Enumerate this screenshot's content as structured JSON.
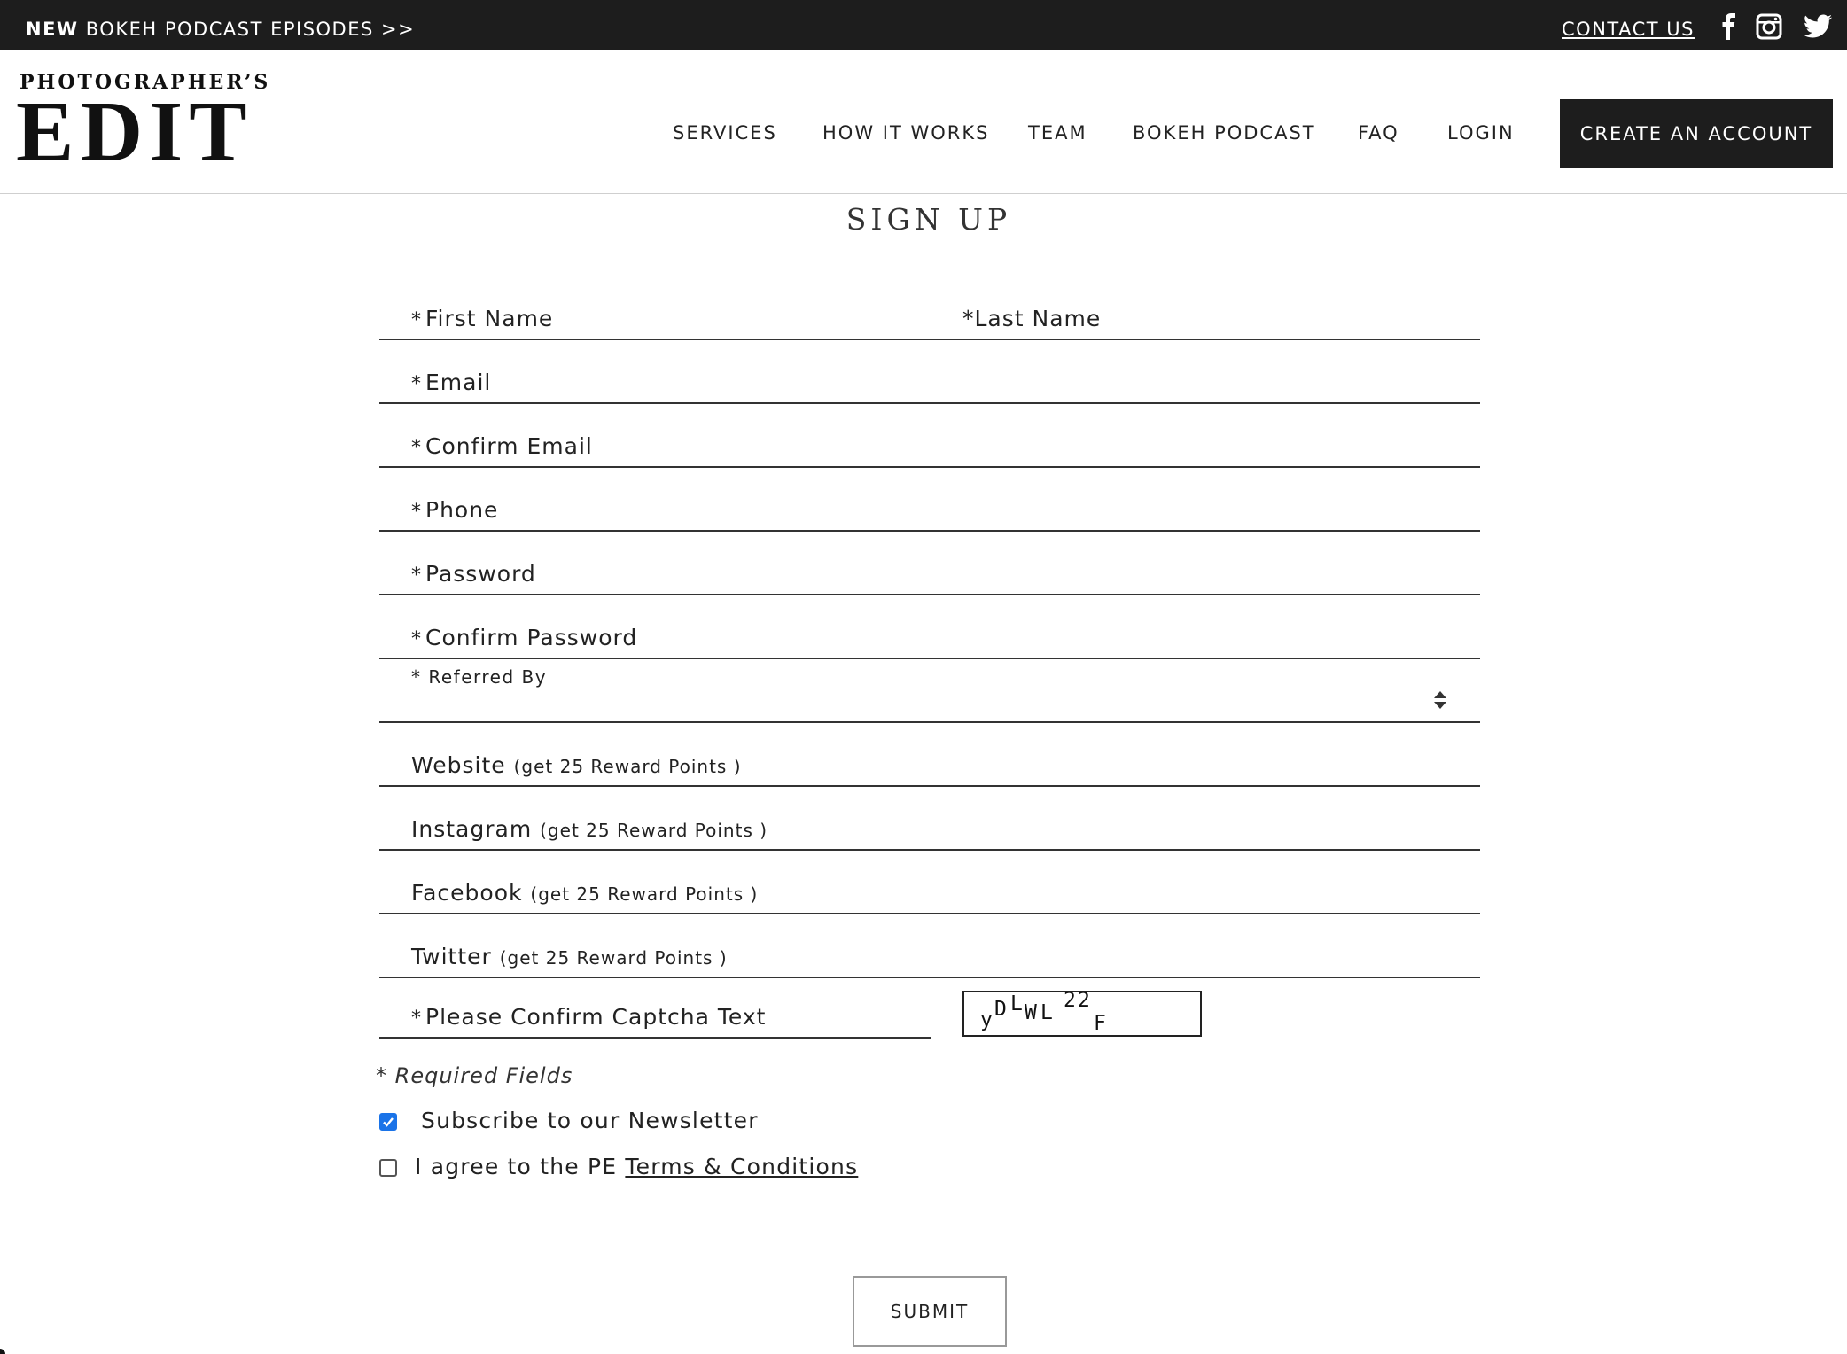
{
  "topbar": {
    "promo_strong": "NEW",
    "promo_text": " BOKEH PODCAST EPISODES >>",
    "contact": "CONTACT US",
    "social_icons": [
      "facebook-icon",
      "instagram-icon",
      "twitter-icon"
    ]
  },
  "logo": {
    "top": "PHOTOGRAPHER’S",
    "main": "EDIT"
  },
  "nav": {
    "items": [
      "SERVICES",
      "HOW IT WORKS",
      "TEAM",
      "BOKEH PODCAST",
      "FAQ",
      "LOGIN"
    ],
    "cta": "CREATE AN ACCOUNT"
  },
  "page": {
    "title": "SIGN UP"
  },
  "form": {
    "required_mark": "*",
    "first_name": "First Name",
    "last_name": "Last Name",
    "email": "Email",
    "confirm_email": "Confirm Email",
    "phone": "Phone",
    "password": "Password",
    "confirm_password": "Confirm Password",
    "referred_by": "Referred By",
    "website": "Website",
    "instagram": "Instagram",
    "facebook": "Facebook",
    "twitter": "Twitter",
    "reward_hint": "(get 25 Reward Points )",
    "captcha_label": "Please Confirm Captcha Text",
    "captcha_chars": [
      "y",
      "D",
      "L",
      "W",
      "L",
      "2",
      "2",
      "F"
    ],
    "required_note": "Required Fields",
    "newsletter": "Subscribe to our Newsletter",
    "newsletter_checked": true,
    "terms_prefix": "I agree to the PE ",
    "terms_link": "Terms & Conditions",
    "terms_checked": false,
    "submit": "SUBMIT"
  },
  "colors": {
    "dark": "#1d1d1d",
    "checkbox_accent": "#1a73e8"
  }
}
